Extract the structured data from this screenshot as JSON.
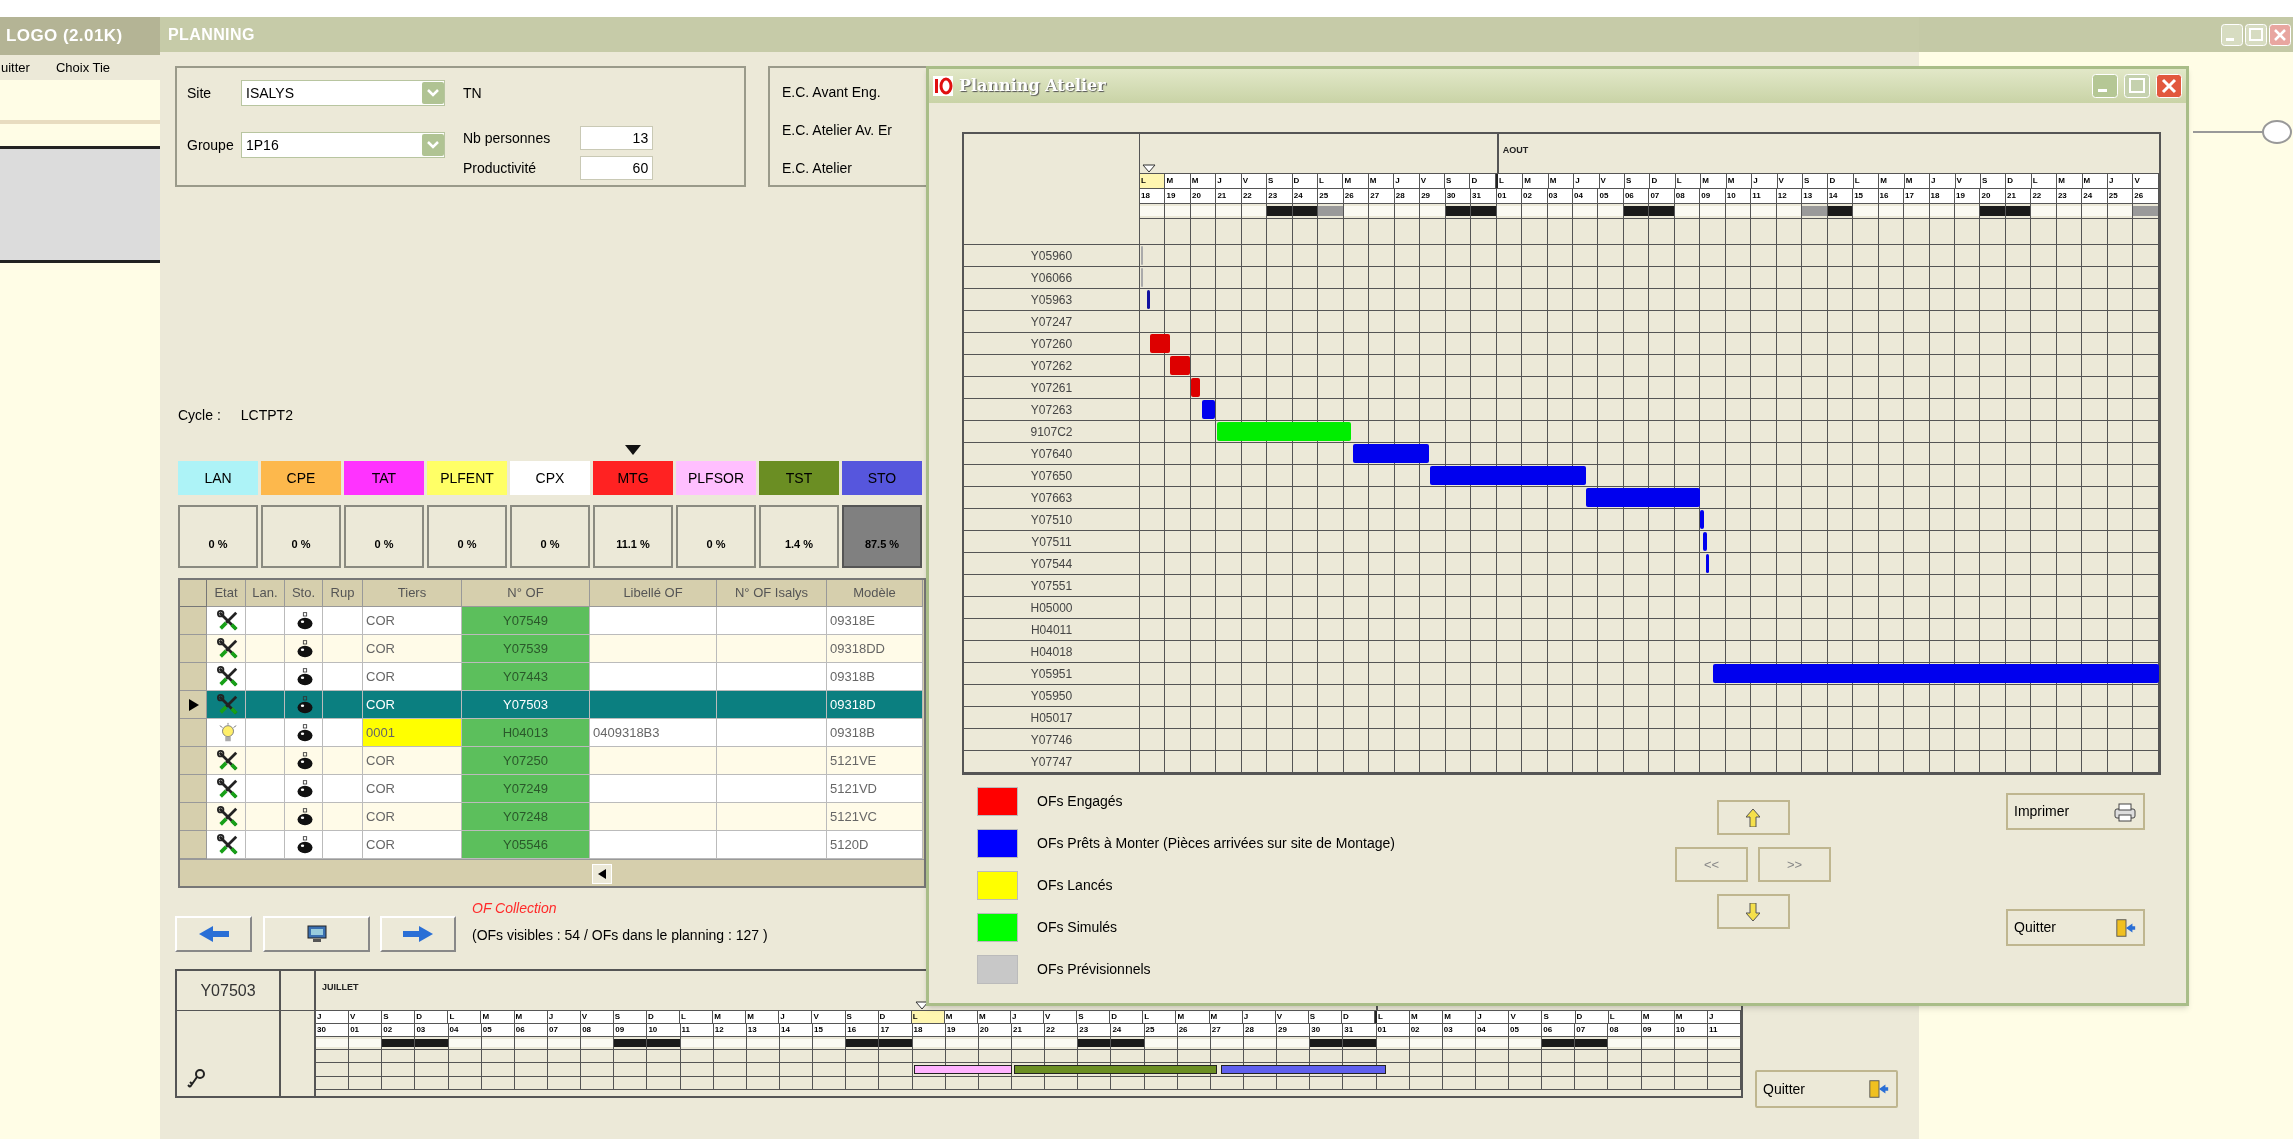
{
  "left_window": {
    "title": "LOGO (2.01K)",
    "menu": [
      "uitter",
      "Choix Tie"
    ]
  },
  "planning": {
    "title": "PLANNING",
    "site": {
      "label": "Site",
      "value": "ISALYS",
      "code": "TN"
    },
    "groupe": {
      "label": "Groupe",
      "value": "1P16"
    },
    "nb_personnes": {
      "label": "Nb personnes",
      "value": "13"
    },
    "productivite": {
      "label": "Productivité",
      "value": "60"
    },
    "ec_labels": [
      "E.C. Avant Eng.",
      "E.C. Atelier Av. Er",
      "E.C. Atelier"
    ],
    "cycle": {
      "label": "Cycle :",
      "value": "LCTPT2"
    },
    "categories": [
      {
        "label": "LAN",
        "color": "#adf3f7",
        "percent": "0 %",
        "current": false,
        "selected": false
      },
      {
        "label": "CPE",
        "color": "#fdb84c",
        "percent": "0 %",
        "current": false,
        "selected": false
      },
      {
        "label": "TAT",
        "color": "#ff33ff",
        "percent": "0 %",
        "current": false,
        "selected": false
      },
      {
        "label": "PLFENT",
        "color": "#ffff66",
        "percent": "0 %",
        "current": false,
        "selected": false
      },
      {
        "label": "CPX",
        "color": "#ffffff",
        "percent": "0 %",
        "current": false,
        "selected": false
      },
      {
        "label": "MTG",
        "color": "#ff2222",
        "percent": "11.1 %",
        "current": true,
        "selected": false
      },
      {
        "label": "PLFSOR",
        "color": "#ffbfff",
        "percent": "0 %",
        "current": false,
        "selected": false
      },
      {
        "label": "TST",
        "color": "#6b8e23",
        "percent": "1.4 %",
        "current": false,
        "selected": false
      },
      {
        "label": "STO",
        "color": "#5656dd",
        "percent": "87.5 %",
        "current": false,
        "selected": true
      }
    ],
    "table": {
      "columns": [
        "Etat",
        "Lan.",
        "Sto.",
        "Rup",
        "Tiers",
        "N° OF",
        "Libellé OF",
        "N° OF Isalys",
        "Modèle"
      ],
      "rows": [
        {
          "kind": "tools",
          "tiers": "COR",
          "tiers_highlighted": false,
          "of": "Y07549",
          "libelle": "",
          "modele": "09318E",
          "selected": false
        },
        {
          "kind": "tools",
          "tiers": "COR",
          "tiers_highlighted": false,
          "of": "Y07539",
          "libelle": "",
          "modele": "09318DD",
          "selected": false
        },
        {
          "kind": "tools",
          "tiers": "COR",
          "tiers_highlighted": false,
          "of": "Y07443",
          "libelle": "",
          "modele": "09318B",
          "selected": false
        },
        {
          "kind": "tools",
          "tiers": "COR",
          "tiers_highlighted": false,
          "of": "Y07503",
          "libelle": "",
          "modele": "09318D",
          "selected": true
        },
        {
          "kind": "bulb",
          "tiers": "0001",
          "tiers_highlighted": true,
          "of": "H04013",
          "libelle": "0409318B3",
          "modele": "09318B",
          "selected": false
        },
        {
          "kind": "tools",
          "tiers": "COR",
          "tiers_highlighted": false,
          "of": "Y07250",
          "libelle": "",
          "modele": "5121VE",
          "selected": false
        },
        {
          "kind": "tools",
          "tiers": "COR",
          "tiers_highlighted": false,
          "of": "Y07249",
          "libelle": "",
          "modele": "5121VD",
          "selected": false
        },
        {
          "kind": "tools",
          "tiers": "COR",
          "tiers_highlighted": false,
          "of": "Y07248",
          "libelle": "",
          "modele": "5121VC",
          "selected": false
        },
        {
          "kind": "tools",
          "tiers": "COR",
          "tiers_highlighted": false,
          "of": "Y05546",
          "libelle": "",
          "modele": "5120D",
          "selected": false
        }
      ]
    },
    "collection_title": "OF Collection",
    "collection_count": "(OFs visibles : 54 / OFs dans le planning : 127 )",
    "timeline": {
      "of": "Y07503",
      "days": [
        {
          "letter": "J",
          "number": "30",
          "month": "JUILLET",
          "month_start": false,
          "kind": "workday",
          "today": false
        },
        {
          "letter": "V",
          "number": "01",
          "month_start": false,
          "kind": "workday",
          "today": false
        },
        {
          "letter": "S",
          "number": "02",
          "month_start": false,
          "kind": "weekend",
          "today": false
        },
        {
          "letter": "D",
          "number": "03",
          "month_start": false,
          "kind": "weekend",
          "today": false
        },
        {
          "letter": "L",
          "number": "04",
          "month_start": false,
          "kind": "workday",
          "today": false
        },
        {
          "letter": "M",
          "number": "05",
          "month_start": false,
          "kind": "workday",
          "today": false
        },
        {
          "letter": "M",
          "number": "06",
          "month_start": false,
          "kind": "workday",
          "today": false
        },
        {
          "letter": "J",
          "number": "07",
          "month_start": false,
          "kind": "workday",
          "today": false
        },
        {
          "letter": "V",
          "number": "08",
          "month_start": false,
          "kind": "workday",
          "today": false
        },
        {
          "letter": "S",
          "number": "09",
          "month_start": false,
          "kind": "weekend",
          "today": false
        },
        {
          "letter": "D",
          "number": "10",
          "month_start": false,
          "kind": "weekend",
          "today": false
        },
        {
          "letter": "L",
          "number": "11",
          "month_start": false,
          "kind": "workday",
          "today": false
        },
        {
          "letter": "M",
          "number": "12",
          "month_start": false,
          "kind": "workday",
          "today": false
        },
        {
          "letter": "M",
          "number": "13",
          "month_start": false,
          "kind": "workday",
          "today": false
        },
        {
          "letter": "J",
          "number": "14",
          "month_start": false,
          "kind": "workday",
          "today": false
        },
        {
          "letter": "V",
          "number": "15",
          "month_start": false,
          "kind": "workday",
          "today": false
        },
        {
          "letter": "S",
          "number": "16",
          "month_start": false,
          "kind": "weekend",
          "today": false
        },
        {
          "letter": "D",
          "number": "17",
          "month_start": false,
          "kind": "weekend",
          "today": false
        },
        {
          "letter": "L",
          "number": "18",
          "month_start": false,
          "kind": "workday",
          "today": true
        },
        {
          "letter": "M",
          "number": "19",
          "month_start": false,
          "kind": "workday",
          "today": false
        },
        {
          "letter": "M",
          "number": "20",
          "month_start": false,
          "kind": "workday",
          "today": false
        },
        {
          "letter": "J",
          "number": "21",
          "month_start": false,
          "kind": "workday",
          "today": false
        },
        {
          "letter": "V",
          "number": "22",
          "month_start": false,
          "kind": "workday",
          "today": false
        },
        {
          "letter": "S",
          "number": "23",
          "month_start": false,
          "kind": "weekend",
          "today": false
        },
        {
          "letter": "D",
          "number": "24",
          "month_start": false,
          "kind": "weekend",
          "today": false
        },
        {
          "letter": "L",
          "number": "25",
          "month_start": false,
          "kind": "workday",
          "today": false
        },
        {
          "letter": "M",
          "number": "26",
          "month_start": false,
          "kind": "workday",
          "today": false
        },
        {
          "letter": "M",
          "number": "27",
          "month_start": false,
          "kind": "workday",
          "today": false
        },
        {
          "letter": "J",
          "number": "28",
          "month_start": false,
          "kind": "workday",
          "today": false
        },
        {
          "letter": "V",
          "number": "29",
          "month_start": false,
          "kind": "workday",
          "today": false
        },
        {
          "letter": "S",
          "number": "30",
          "month_start": false,
          "kind": "weekend",
          "today": false
        },
        {
          "letter": "D",
          "number": "31",
          "month_start": false,
          "kind": "weekend",
          "today": false
        },
        {
          "letter": "L",
          "number": "01",
          "month_start": true,
          "kind": "workday",
          "today": false
        },
        {
          "letter": "M",
          "number": "02",
          "month_start": false,
          "kind": "workday",
          "today": false
        },
        {
          "letter": "M",
          "number": "03",
          "month_start": false,
          "kind": "workday",
          "today": false
        },
        {
          "letter": "J",
          "number": "04",
          "month_start": false,
          "kind": "workday",
          "today": false
        },
        {
          "letter": "V",
          "number": "05",
          "month_start": false,
          "kind": "workday",
          "today": false
        },
        {
          "letter": "S",
          "number": "06",
          "month_start": false,
          "kind": "weekend",
          "today": false
        },
        {
          "letter": "D",
          "number": "07",
          "month_start": false,
          "kind": "weekend",
          "today": false
        },
        {
          "letter": "L",
          "number": "08",
          "month_start": false,
          "kind": "workday",
          "today": false
        },
        {
          "letter": "M",
          "number": "09",
          "month_start": false,
          "kind": "workday",
          "today": false
        },
        {
          "letter": "M",
          "number": "10",
          "month_start": false,
          "kind": "workday",
          "today": false
        },
        {
          "letter": "J",
          "number": "11",
          "month_start": false,
          "kind": "workday",
          "today": false
        }
      ],
      "bars": [
        {
          "color": "#ffb3ff"
        },
        {
          "color": "#6b8e23"
        },
        {
          "color": "#6060ee"
        }
      ]
    },
    "quit_button": "Quitter"
  },
  "atelier": {
    "title": "Planning Atelier",
    "days": [
      {
        "letter": "L",
        "number": "18",
        "month_start": false,
        "kind": "workday",
        "today": true
      },
      {
        "letter": "M",
        "number": "19",
        "month_start": false,
        "kind": "workday",
        "today": false
      },
      {
        "letter": "M",
        "number": "20",
        "month_start": false,
        "kind": "workday",
        "today": false
      },
      {
        "letter": "J",
        "number": "21",
        "month_start": false,
        "kind": "workday",
        "today": false
      },
      {
        "letter": "V",
        "number": "22",
        "month_start": false,
        "kind": "workday",
        "today": false
      },
      {
        "letter": "S",
        "number": "23",
        "month_start": false,
        "kind": "weekend",
        "today": false
      },
      {
        "letter": "D",
        "number": "24",
        "month_start": false,
        "kind": "weekend",
        "today": false
      },
      {
        "letter": "L",
        "number": "25",
        "month_start": false,
        "kind": "holiday",
        "today": false
      },
      {
        "letter": "M",
        "number": "26",
        "month_start": false,
        "kind": "workday",
        "today": false
      },
      {
        "letter": "M",
        "number": "27",
        "month_start": false,
        "kind": "workday",
        "today": false
      },
      {
        "letter": "J",
        "number": "28",
        "month_start": false,
        "kind": "workday",
        "today": false
      },
      {
        "letter": "V",
        "number": "29",
        "month_start": false,
        "kind": "workday",
        "today": false
      },
      {
        "letter": "S",
        "number": "30",
        "month_start": false,
        "kind": "weekend",
        "today": false
      },
      {
        "letter": "D",
        "number": "31",
        "month_start": false,
        "kind": "weekend",
        "today": false
      },
      {
        "letter": "L",
        "number": "01",
        "month": "AOUT",
        "month_start": true,
        "kind": "workday",
        "today": false
      },
      {
        "letter": "M",
        "number": "02",
        "month_start": false,
        "kind": "workday",
        "today": false
      },
      {
        "letter": "M",
        "number": "03",
        "month_start": false,
        "kind": "workday",
        "today": false
      },
      {
        "letter": "J",
        "number": "04",
        "month_start": false,
        "kind": "workday",
        "today": false
      },
      {
        "letter": "V",
        "number": "05",
        "month_start": false,
        "kind": "workday",
        "today": false
      },
      {
        "letter": "S",
        "number": "06",
        "month_start": false,
        "kind": "weekend",
        "today": false
      },
      {
        "letter": "D",
        "number": "07",
        "month_start": false,
        "kind": "weekend",
        "today": false
      },
      {
        "letter": "L",
        "number": "08",
        "month_start": false,
        "kind": "workday",
        "today": false
      },
      {
        "letter": "M",
        "number": "09",
        "month_start": false,
        "kind": "workday",
        "today": false
      },
      {
        "letter": "M",
        "number": "10",
        "month_start": false,
        "kind": "workday",
        "today": false
      },
      {
        "letter": "J",
        "number": "11",
        "month_start": false,
        "kind": "workday",
        "today": false
      },
      {
        "letter": "V",
        "number": "12",
        "month_start": false,
        "kind": "workday",
        "today": false
      },
      {
        "letter": "S",
        "number": "13",
        "month_start": false,
        "kind": "holiday",
        "today": false
      },
      {
        "letter": "D",
        "number": "14",
        "month_start": false,
        "kind": "weekend",
        "today": false
      },
      {
        "letter": "L",
        "number": "15",
        "month_start": false,
        "kind": "workday",
        "today": false
      },
      {
        "letter": "M",
        "number": "16",
        "month_start": false,
        "kind": "workday",
        "today": false
      },
      {
        "letter": "M",
        "number": "17",
        "month_start": false,
        "kind": "workday",
        "today": false
      },
      {
        "letter": "J",
        "number": "18",
        "month_start": false,
        "kind": "workday",
        "today": false
      },
      {
        "letter": "V",
        "number": "19",
        "month_start": false,
        "kind": "workday",
        "today": false
      },
      {
        "letter": "S",
        "number": "20",
        "month_start": false,
        "kind": "weekend",
        "today": false
      },
      {
        "letter": "D",
        "number": "21",
        "month_start": false,
        "kind": "weekend",
        "today": false
      },
      {
        "letter": "L",
        "number": "22",
        "month_start": false,
        "kind": "workday",
        "today": false
      },
      {
        "letter": "M",
        "number": "23",
        "month_start": false,
        "kind": "workday",
        "today": false
      },
      {
        "letter": "M",
        "number": "24",
        "month_start": false,
        "kind": "workday",
        "today": false
      },
      {
        "letter": "J",
        "number": "25",
        "month_start": false,
        "kind": "workday",
        "today": false
      },
      {
        "letter": "V",
        "number": "26",
        "month_start": false,
        "kind": "holiday",
        "today": false
      }
    ],
    "rows": [
      {
        "label": "Y05960",
        "bars": [
          {
            "color": "#aaaaaa"
          }
        ]
      },
      {
        "label": "Y06066",
        "bars": [
          {
            "color": "#aaaaaa"
          }
        ]
      },
      {
        "label": "Y05963",
        "bars": [
          {
            "color": "#1010a0"
          }
        ]
      },
      {
        "label": "Y07247",
        "bars": []
      },
      {
        "label": "Y07260",
        "bars": [
          {
            "color": "#dd0000"
          }
        ]
      },
      {
        "label": "Y07262",
        "bars": [
          {
            "color": "#dd0000"
          }
        ]
      },
      {
        "label": "Y07261",
        "bars": [
          {
            "color": "#dd0000"
          }
        ]
      },
      {
        "label": "Y07263",
        "bars": [
          {
            "color": "#0000ee"
          }
        ]
      },
      {
        "label": "9107C2",
        "bars": [
          {
            "color": "#00ee00"
          }
        ]
      },
      {
        "label": "Y07640",
        "bars": [
          {
            "color": "#0000ee"
          }
        ]
      },
      {
        "label": "Y07650",
        "bars": [
          {
            "color": "#0000ee"
          }
        ]
      },
      {
        "label": "Y07663",
        "bars": [
          {
            "color": "#0000ee"
          }
        ]
      },
      {
        "label": "Y07510",
        "bars": [
          {
            "color": "#0000ee"
          }
        ]
      },
      {
        "label": "Y07511",
        "bars": [
          {
            "color": "#0000ee"
          }
        ]
      },
      {
        "label": "Y07544",
        "bars": [
          {
            "color": "#0000ee"
          }
        ]
      },
      {
        "label": "Y07551",
        "bars": []
      },
      {
        "label": "H05000",
        "bars": []
      },
      {
        "label": "H04011",
        "bars": []
      },
      {
        "label": "H04018",
        "bars": []
      },
      {
        "label": "Y05951",
        "bars": [
          {
            "color": "#0000ee"
          }
        ]
      },
      {
        "label": "Y05950",
        "bars": []
      },
      {
        "label": "H05017",
        "bars": []
      },
      {
        "label": "Y07746",
        "bars": []
      },
      {
        "label": "Y07747",
        "bars": []
      }
    ],
    "legend": [
      {
        "label": "OFs Engagés",
        "color": "#ff0000"
      },
      {
        "label": "OFs Prêts à Monter (Pièces arrivées sur site de Montage)",
        "color": "#0000ff"
      },
      {
        "label": "OFs Lancés",
        "color": "#ffff00"
      },
      {
        "label": "OFs Simulés",
        "color": "#00ff00"
      },
      {
        "label": "OFs Prévisionnels",
        "color": "#c8c8c8"
      }
    ],
    "previous_button": "<<",
    "next_button": ">>",
    "print_button": "Imprimer",
    "quit_button": "Quitter"
  }
}
